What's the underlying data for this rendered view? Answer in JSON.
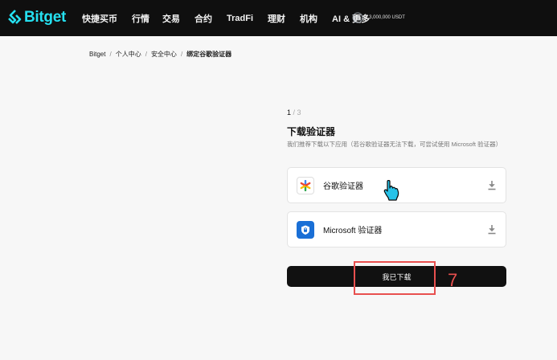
{
  "header": {
    "logo_text": "Bitget",
    "logo_color": "#25e0f0",
    "nav": [
      {
        "label": "快捷买币"
      },
      {
        "label": "行情"
      },
      {
        "label": "交易"
      },
      {
        "label": "合约"
      },
      {
        "label": "TradFi"
      },
      {
        "label": "理财"
      },
      {
        "label": "机构"
      },
      {
        "label": "AI & 更多"
      }
    ],
    "promo_text": "+ 3,000,000 USDT"
  },
  "breadcrumb": {
    "items": [
      "Bitget",
      "个人中心",
      "安全中心"
    ],
    "current": "绑定谷歌验证器",
    "separator": "/"
  },
  "main": {
    "step_current": "1",
    "step_total": "/ 3",
    "title": "下载验证器",
    "description": "我们推荐下载以下应用（若谷歌验证器无法下载，可尝试使用 Microsoft 验证器）",
    "apps": [
      {
        "name": "谷歌验证器",
        "icon": "google-authenticator-icon"
      },
      {
        "name": "Microsoft 验证器",
        "icon": "microsoft-authenticator-icon"
      }
    ],
    "confirm_label": "我已下载"
  },
  "annotation": {
    "number": "7",
    "color": "#e8504f"
  }
}
